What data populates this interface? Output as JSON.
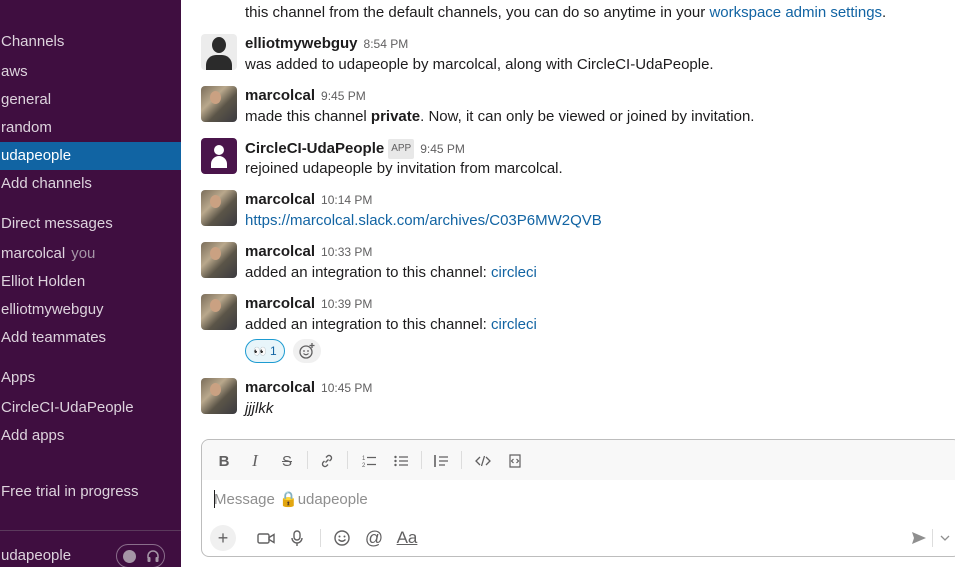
{
  "sidebar": {
    "sections": [
      {
        "label": "Channels"
      },
      {
        "label": "Direct messages"
      },
      {
        "label": "Apps"
      }
    ],
    "channels": [
      "aws",
      "general",
      "random",
      "udapeople"
    ],
    "active_channel": "udapeople",
    "add_channels": "Add channels",
    "direct_messages": [
      {
        "name": "marcolcal",
        "suffix": "you"
      },
      {
        "name": "Elliot Holden"
      },
      {
        "name": "elliotmywebguy"
      }
    ],
    "add_teammates": "Add teammates",
    "apps": [
      "CircleCI-UdaPeople"
    ],
    "add_apps": "Add apps",
    "trial": "Free trial in progress",
    "footer_channel": "udapeople"
  },
  "messages": {
    "intro_text": "this channel from the default channels, you can do so anytime in your",
    "intro_link": "workspace admin settings",
    "intro_end": ".",
    "items": [
      {
        "author": "elliotmywebguy",
        "time": "8:54 PM",
        "text": "was added to udapeople by marcolcal, along with CircleCI-UdaPeople."
      },
      {
        "author": "marcolcal",
        "time": "9:45 PM",
        "text_pre": "made this channel ",
        "text_bold": "private",
        "text_post": ". Now, it can only be viewed or joined by invitation."
      },
      {
        "author": "CircleCI-UdaPeople",
        "badge": "APP",
        "time": "9:45 PM",
        "text": "rejoined udapeople by invitation from marcolcal."
      },
      {
        "author": "marcolcal",
        "time": "10:14 PM",
        "link": "https://marcolcal.slack.com/archives/C03P6MW2QVB"
      },
      {
        "author": "marcolcal",
        "time": "10:33 PM",
        "text": "added an integration to this channel: ",
        "link": "circleci"
      },
      {
        "author": "marcolcal",
        "time": "10:39 PM",
        "text": "added an integration to this channel: ",
        "link": "circleci",
        "reaction_emoji": "👀",
        "reaction_count": "1"
      },
      {
        "author": "marcolcal",
        "time": "10:45 PM",
        "text": "jjjlkk"
      }
    ]
  },
  "composer": {
    "placeholder": "Message 🔒udapeople",
    "value": ""
  },
  "icons": {
    "format": [
      "bold-icon",
      "italic-icon",
      "strikethrough-icon",
      "link-icon",
      "ordered-list-icon",
      "bullet-list-icon",
      "blockquote-icon",
      "code-icon",
      "code-block-icon"
    ],
    "actions": [
      "plus-icon",
      "video-icon",
      "microphone-icon",
      "emoji-icon",
      "mention-icon",
      "formatting-icon",
      "send-icon",
      "chevron-down-icon",
      "headphones-icon"
    ]
  }
}
